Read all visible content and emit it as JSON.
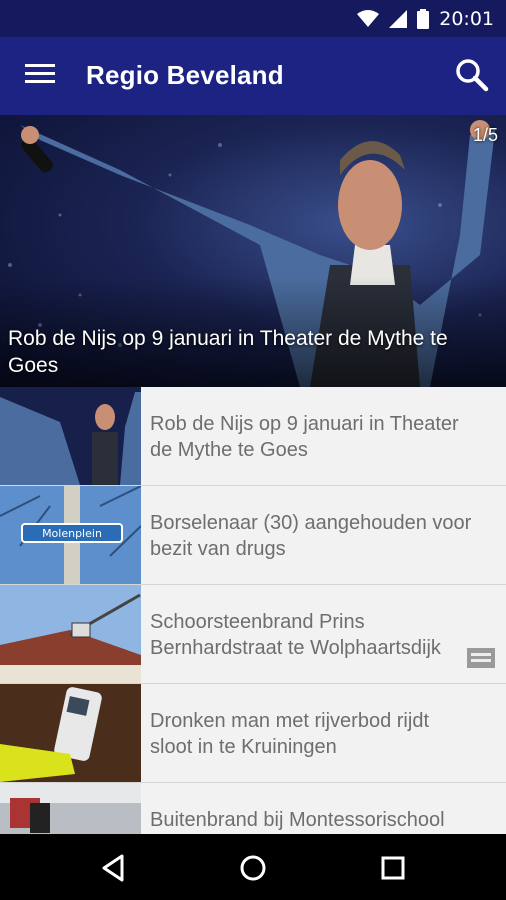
{
  "status_bar": {
    "time": "20:01",
    "icons": [
      "wifi-icon",
      "signal-icon",
      "battery-icon"
    ]
  },
  "app_bar": {
    "title": "Regio Beveland",
    "menu_icon": "hamburger-menu-icon",
    "search_icon": "search-icon"
  },
  "hero": {
    "counter": "1/5",
    "caption": "Rob de Nijs op 9 januari in Theater de Mythe te Goes"
  },
  "news_items": [
    {
      "title_line1": "Rob de Nijs op 9 januari in Theater",
      "title_line2": "de Mythe te Goes"
    },
    {
      "title_line1": "Borselenaar (30) aangehouden voor",
      "title_line2": "bezit van drugs",
      "thumb_sign": "Molenplein"
    },
    {
      "title_line1": "Schoorsteenbrand Prins",
      "title_line2": "Bernhardstraat te Wolphaartsdijk"
    },
    {
      "title_line1": "Dronken man met rijverbod rijdt",
      "title_line2": "sloot in te Kruiningen"
    },
    {
      "title_line1": "Buitenbrand bij Montessorischool",
      "title_line2": ""
    }
  ],
  "nav_bar": {
    "icons": [
      "back-icon",
      "home-icon",
      "recents-icon"
    ]
  },
  "colors": {
    "status_bar": "#151a5e",
    "app_bar": "#1c2382",
    "list_bg": "#f2f2f2",
    "list_text": "#6e6e6e"
  }
}
